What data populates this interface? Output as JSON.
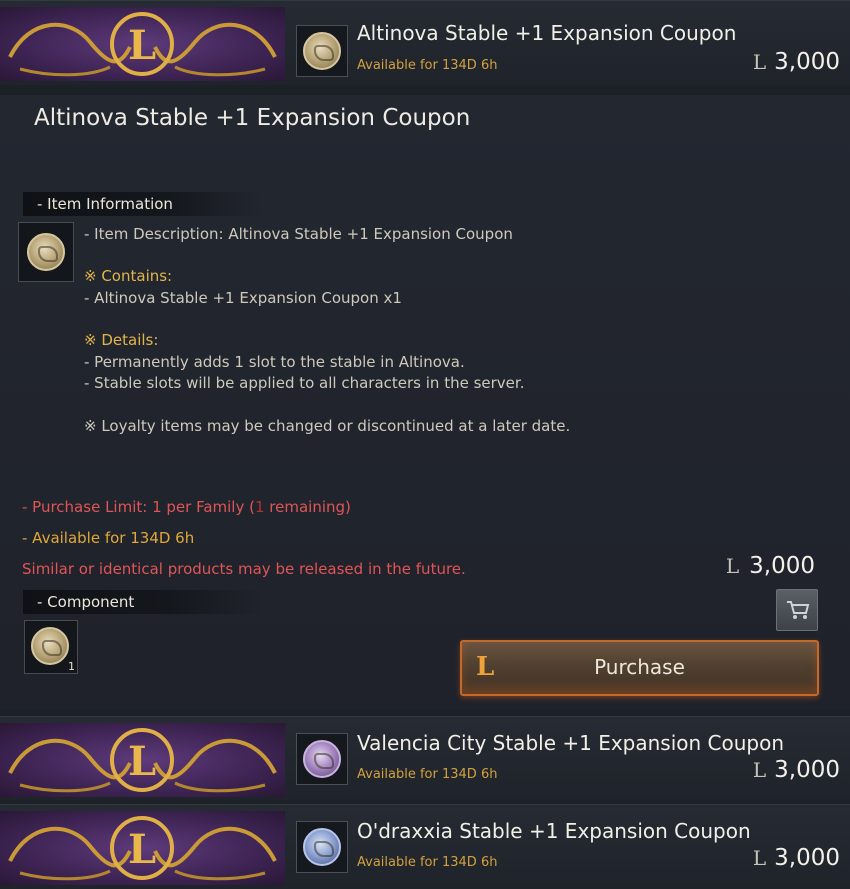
{
  "listings": [
    {
      "title": "Altinova Stable +1 Expansion Coupon",
      "availability": "Available for 134D 6h",
      "price_symbol": "L",
      "price": "3,000",
      "coin": "gold"
    },
    {
      "title": "Valencia City Stable +1 Expansion Coupon",
      "availability": "Available for 134D 6h",
      "price_symbol": "L",
      "price": "3,000",
      "coin": "purple"
    },
    {
      "title": "O'draxxia Stable +1 Expansion Coupon",
      "availability": "Available for 134D 6h",
      "price_symbol": "L",
      "price": "3,000",
      "coin": "blue"
    }
  ],
  "detail": {
    "title": "Altinova Stable +1 Expansion Coupon",
    "info_header": "- Item Information",
    "description": "- Item Description: Altinova Stable +1 Expansion Coupon",
    "contains_header": "※ Contains:",
    "contains_item": "- Altinova Stable +1 Expansion Coupon x1",
    "details_header": "※ Details:",
    "details_1": "- Permanently adds 1 slot to the stable in Altinova.",
    "details_2": "- Stable slots will be applied to all characters in the server.",
    "loyalty_note": "※ Loyalty items may be changed or discontinued at a later date.",
    "purchase_limit_prefix": "- Purchase Limit: 1 per Family (",
    "purchase_limit_count": "1",
    "purchase_limit_suffix": " remaining)",
    "availability": "- Available for 134D 6h",
    "similar_note": "Similar or identical products may be released in the future.",
    "price_symbol": "L",
    "price": "3,000",
    "component_header": "- Component",
    "component_qty": "1",
    "purchase_symbol": "L",
    "purchase_label": "Purchase"
  },
  "colors": {
    "gold": "#e2b54a",
    "red": "#e05555",
    "orange_button_border": "#c36a2a",
    "banner_purple": "#5e3a7a"
  },
  "icons": [
    "loyalty-l-emblem-icon",
    "coupon-coin-icon",
    "shopping-cart-icon"
  ]
}
